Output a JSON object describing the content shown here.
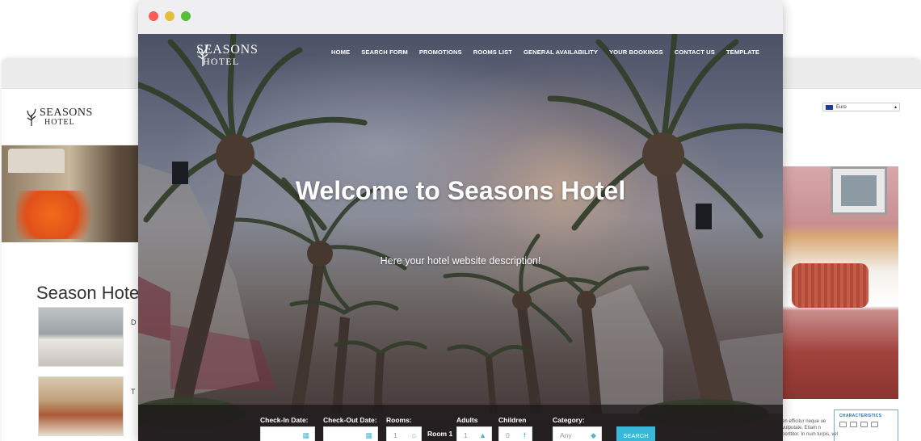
{
  "left_window": {
    "logo_line1": "SEASONS",
    "logo_line2": "HOTEL",
    "title": "Season Hotel",
    "snippet1": "D",
    "snippet2": "T"
  },
  "right_window": {
    "currency_label": "Euro",
    "characteristics_title": "CHARACTERISTICS",
    "text_snippet": "en efficitur neque ue vulputate. Etiam n porttitor. In num turpis, vel"
  },
  "main_window": {
    "brand_line1": "SEASONS",
    "brand_line2": "HOTEL",
    "nav": [
      "HOME",
      "SEARCH FORM",
      "PROMOTIONS",
      "ROOMS LIST",
      "GENERAL AVAILABILITY",
      "YOUR BOOKINGS",
      "CONTACT US",
      "TEMPLATE"
    ],
    "headline": "Welcome to Seasons Hotel",
    "description": "Here your hotel website description!",
    "booking": {
      "checkin_label": "Check-In Date:",
      "checkout_label": "Check-Out Date:",
      "rooms_label": "Rooms:",
      "rooms_value": "1",
      "room_name": "Room 1",
      "adults_label": "Adults",
      "adults_value": "1",
      "children_label": "Children",
      "children_value": "0",
      "category_label": "Category:",
      "category_value": "Any",
      "search_label": "SEARCH"
    }
  },
  "colors": {
    "close": "#fc5b57",
    "minimize": "#e5bf3c",
    "maximize": "#57c038",
    "accent": "#39b6d8"
  }
}
